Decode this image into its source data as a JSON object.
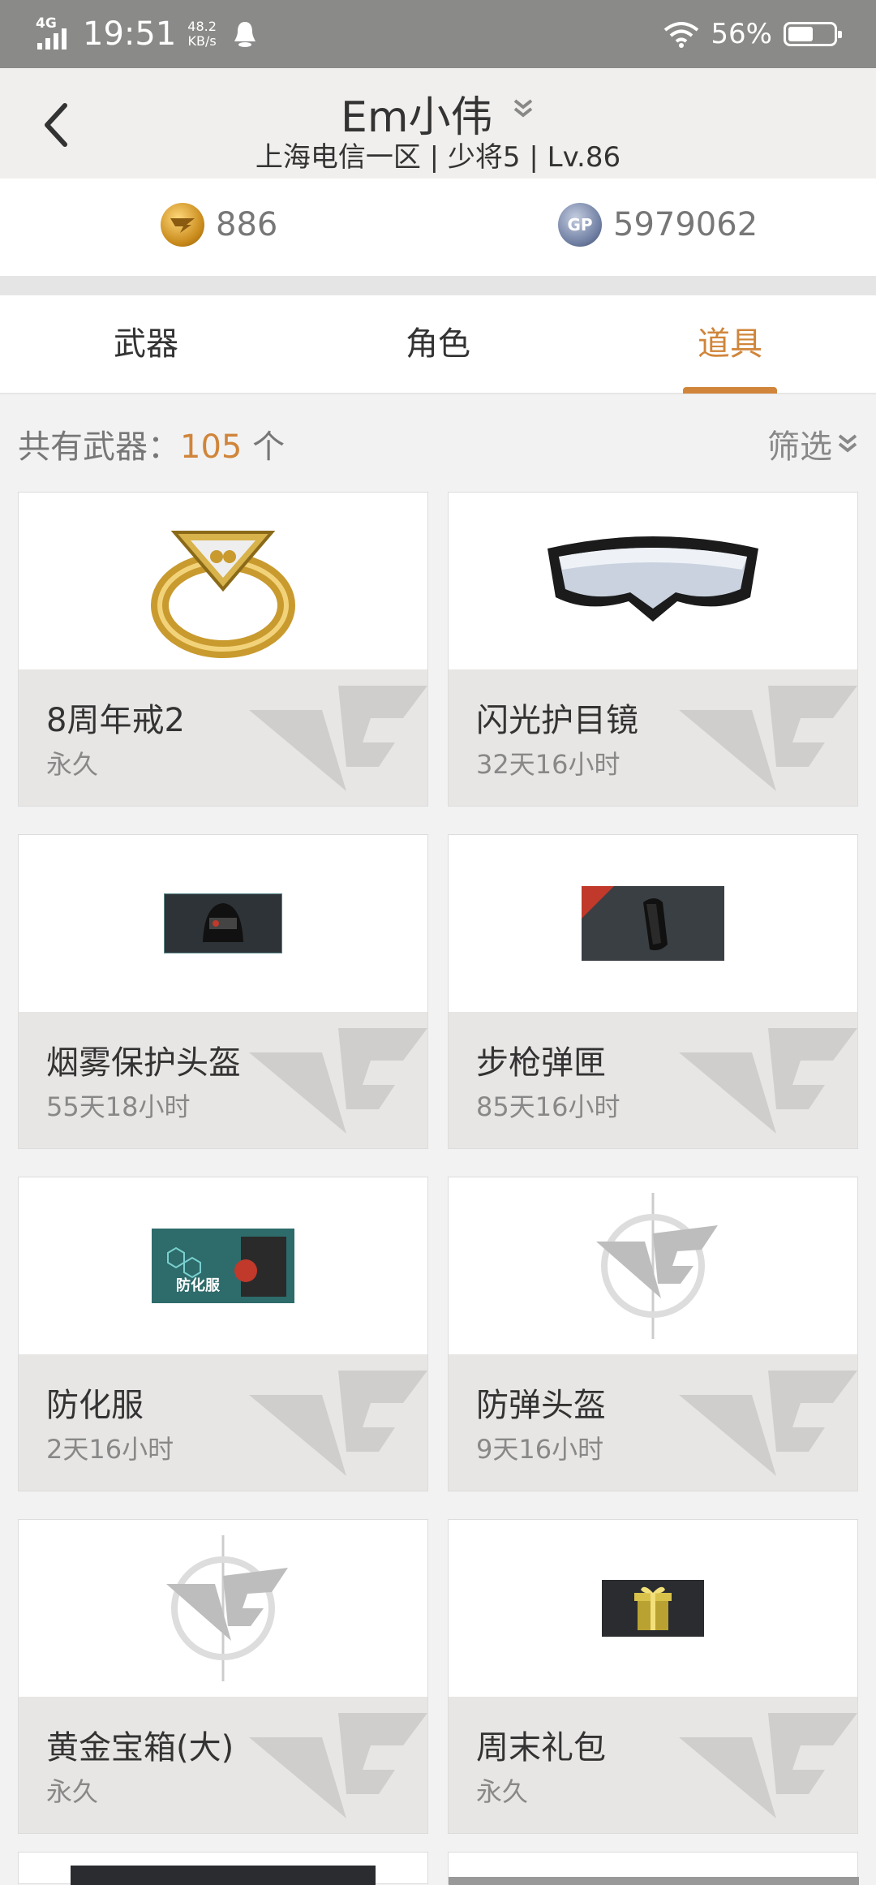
{
  "status_bar": {
    "network": "4G",
    "time": "19:51",
    "speed_value": "48.2",
    "speed_unit": "KB/s",
    "battery_percent": "56%",
    "battery_level": 0.56
  },
  "header": {
    "title": "Em小伟",
    "subtitle": "上海电信一区 | 少将5 | Lv.86"
  },
  "currency": {
    "cf_points": "886",
    "gp_points": "5979062",
    "cf_icon": "cf-coin-icon",
    "gp_icon": "gp-coin-icon",
    "gp_label": "GP"
  },
  "tabs": [
    {
      "label": "武器"
    },
    {
      "label": "角色"
    },
    {
      "label": "道具"
    }
  ],
  "active_tab": 2,
  "summary": {
    "prefix": "共有武器：",
    "count": "105",
    "suffix": " 个",
    "filter_label": "筛选"
  },
  "items": [
    {
      "name": "8周年戒2",
      "duration": "永久",
      "icon": "ring-icon"
    },
    {
      "name": "闪光护目镜",
      "duration": "32天16小时",
      "icon": "goggles-icon"
    },
    {
      "name": "烟雾保护头盔",
      "duration": "55天18小时",
      "icon": "helmet-icon"
    },
    {
      "name": "步枪弹匣",
      "duration": "85天16小时",
      "icon": "magazine-icon"
    },
    {
      "name": "防化服",
      "duration": "2天16小时",
      "icon": "hazmat-suit-icon",
      "badge": "防化服"
    },
    {
      "name": "防弹头盔",
      "duration": "9天16小时",
      "icon": "cf-placeholder-icon"
    },
    {
      "name": "黄金宝箱(大)",
      "duration": "永久",
      "icon": "cf-placeholder-icon"
    },
    {
      "name": "周末礼包",
      "duration": "永久",
      "icon": "gift-box-icon"
    }
  ],
  "colors": {
    "accent": "#d0853a",
    "status_bar": "#8a8a88",
    "card_footer": "#e8e6e4"
  }
}
